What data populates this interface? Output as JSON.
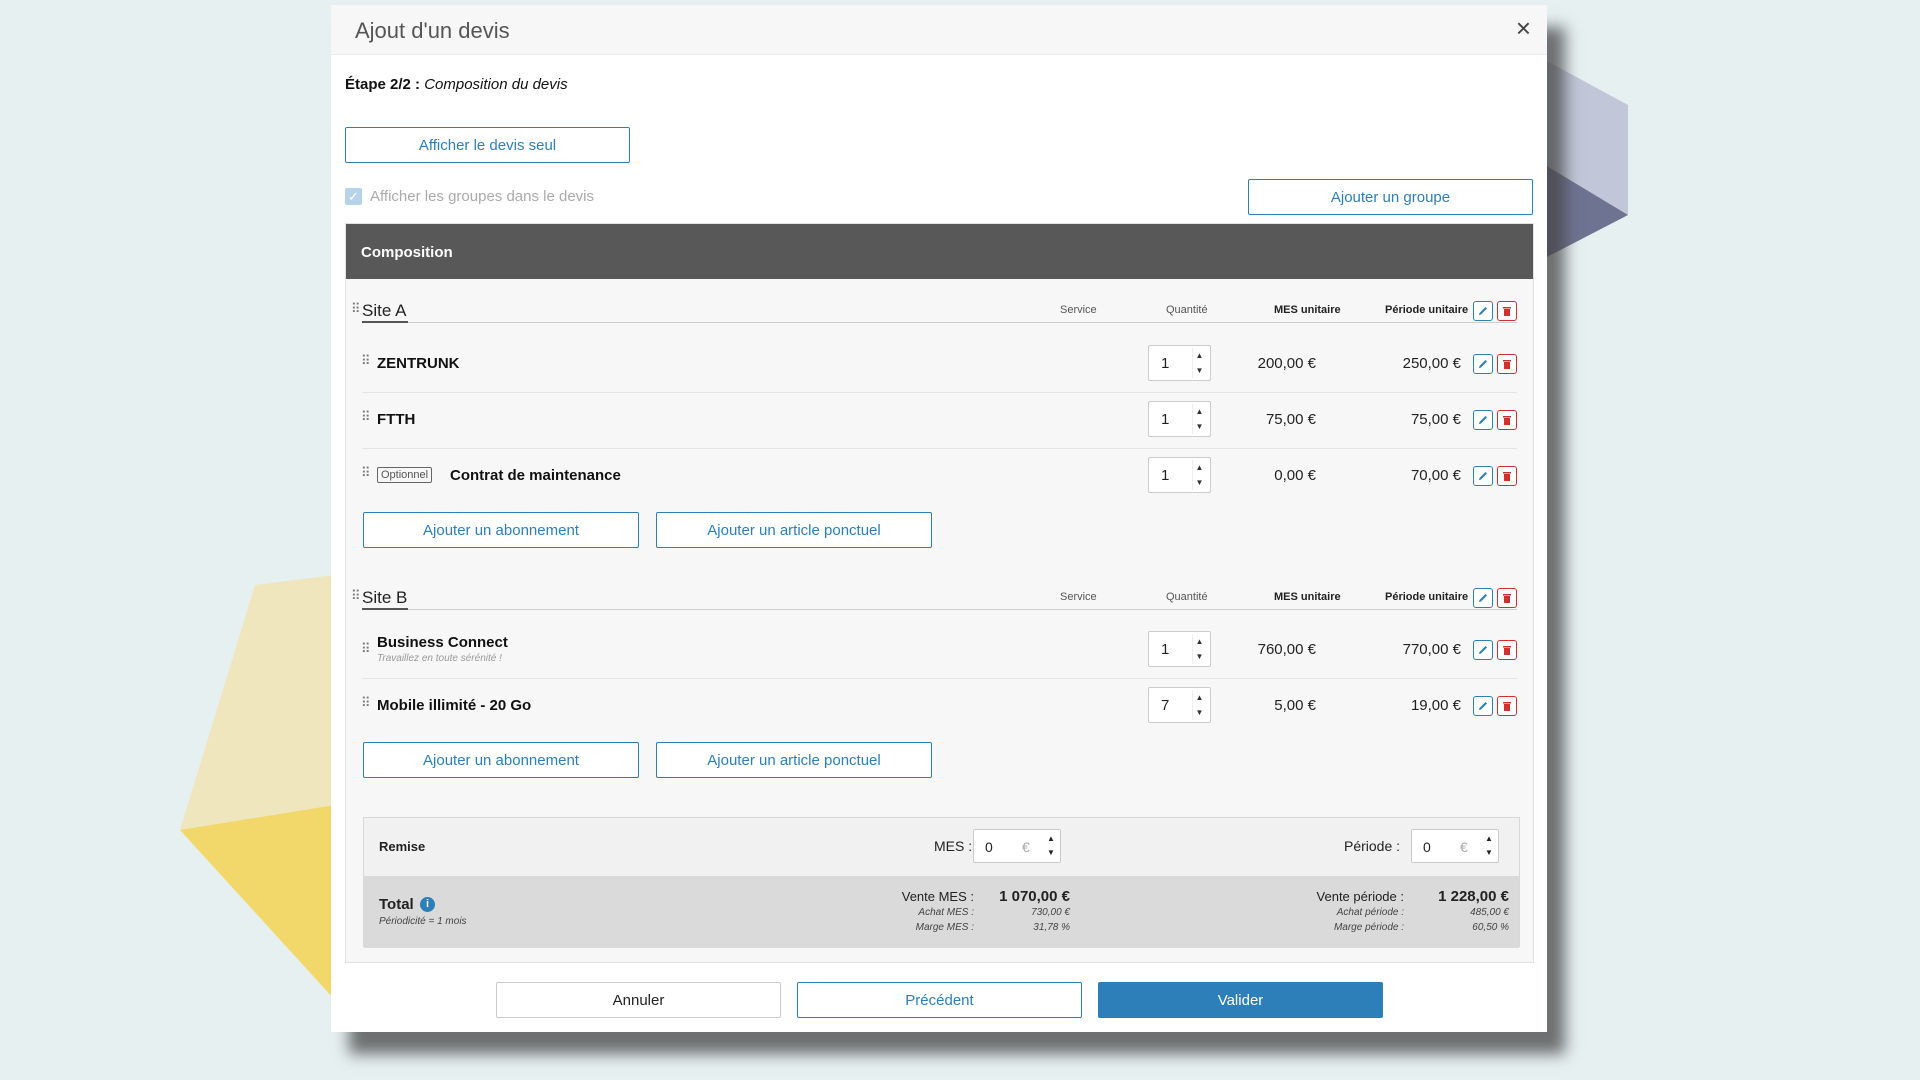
{
  "modal": {
    "title": "Ajout d'un devis",
    "close_symbol": "×",
    "step_label": "Étape 2/2 :",
    "step_name": "Composition du devis",
    "show_quote_button": "Afficher le devis seul",
    "show_groups_checkbox": {
      "label": "Afficher les groupes dans le devis",
      "checked": true
    },
    "add_group_button": "Ajouter un groupe"
  },
  "composition": {
    "header": "Composition",
    "columns": {
      "service": "Service",
      "quantity": "Quantité",
      "mes_unit": "MES unitaire",
      "period_unit": "Période unitaire"
    },
    "groups": [
      {
        "title": "Site A",
        "items": [
          {
            "name": "ZENTRUNK",
            "subtitle": "",
            "optional": false,
            "quantity": "1",
            "mes": "200,00 €",
            "period": "250,00 €"
          },
          {
            "name": "FTTH",
            "subtitle": "",
            "optional": false,
            "quantity": "1",
            "mes": "75,00 €",
            "period": "75,00 €"
          },
          {
            "name": "Contrat de maintenance",
            "subtitle": "",
            "optional": true,
            "optional_label": "Optionnel",
            "quantity": "1",
            "mes": "0,00 €",
            "period": "70,00 €"
          }
        ],
        "add_subscription": "Ajouter un abonnement",
        "add_article": "Ajouter un article ponctuel"
      },
      {
        "title": "Site B",
        "items": [
          {
            "name": "Business Connect",
            "subtitle": "Travaillez en toute sérénité !",
            "optional": false,
            "quantity": "1",
            "mes": "760,00 €",
            "period": "770,00 €"
          },
          {
            "name": "Mobile illimité - 20 Go",
            "subtitle": "",
            "optional": false,
            "quantity": "7",
            "mes": "5,00 €",
            "period": "19,00 €"
          }
        ],
        "add_subscription": "Ajouter un abonnement",
        "add_article": "Ajouter un article ponctuel"
      }
    ]
  },
  "discount": {
    "label": "Remise",
    "mes_label": "MES :",
    "mes_value": "0",
    "period_label": "Période :",
    "period_value": "0",
    "currency": "€"
  },
  "total": {
    "label": "Total",
    "periodicity": "Périodicité = 1 mois",
    "sale_mes_label": "Vente MES :",
    "sale_mes_value": "1 070,00 €",
    "purchase_mes_label": "Achat MES :",
    "purchase_mes_value": "730,00 €",
    "margin_mes_label": "Marge MES :",
    "margin_mes_value": "31,78 %",
    "sale_period_label": "Vente période :",
    "sale_period_value": "1 228,00 €",
    "purchase_period_label": "Achat période :",
    "purchase_period_value": "485,00 €",
    "margin_period_label": "Marge période :",
    "margin_period_value": "60,50 %"
  },
  "footer": {
    "cancel": "Annuler",
    "previous": "Précédent",
    "validate": "Valider"
  },
  "colors": {
    "accent": "#2c7fb8",
    "danger": "#d0312d",
    "header_dark": "#585858"
  }
}
